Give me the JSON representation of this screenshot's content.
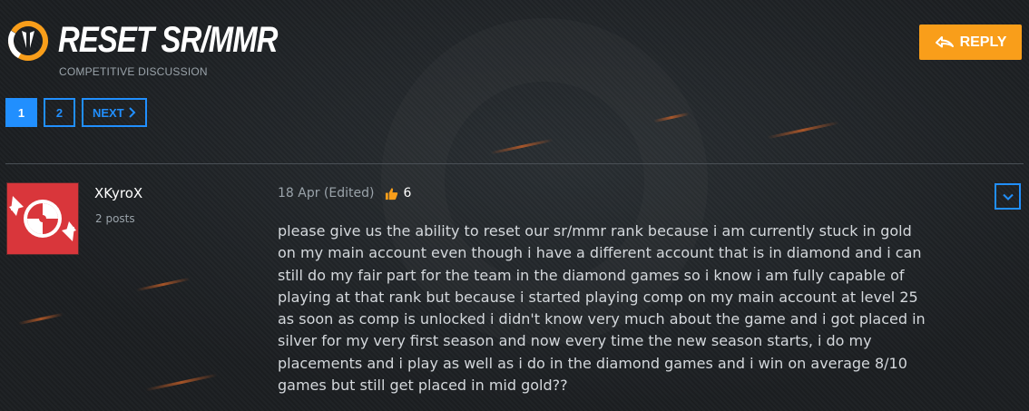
{
  "thread": {
    "title": "RESET SR/MMR",
    "category": "COMPETITIVE DISCUSSION",
    "reply_label": "REPLY"
  },
  "pagination": {
    "pages": [
      "1",
      "2"
    ],
    "current": "1",
    "next_label": "NEXT"
  },
  "post": {
    "author": "XKyroX",
    "post_count": "2 posts",
    "date": "18 Apr (Edited)",
    "likes": "6",
    "body": "please give us the ability to reset our sr/mmr rank because i am currently stuck in gold on my main account even though i have a different account that is in diamond and i can still do my fair part for the team in the diamond games so i know i am fully capable of playing at that rank but because i started playing comp on my main account at level 25 as soon as comp is unlocked i didn't know very much about the game and i got placed in silver for my very first season and now every time the new season starts, i do my placements and i play as well as i do in the diamond games and i win on average 8/10 games but still get placed in mid gold??"
  },
  "icons": {
    "logo": "overwatch-logo-icon",
    "reply": "reply-arrow-icon",
    "next": "chevron-right-icon",
    "like": "thumbs-up-icon",
    "menu": "chevron-down-icon",
    "avatar": "candy-icon"
  },
  "colors": {
    "accent_blue": "#218ffe",
    "reply_orange": "#f99e1a",
    "like_orange": "#f99e1a",
    "avatar_red": "#d9363b"
  }
}
